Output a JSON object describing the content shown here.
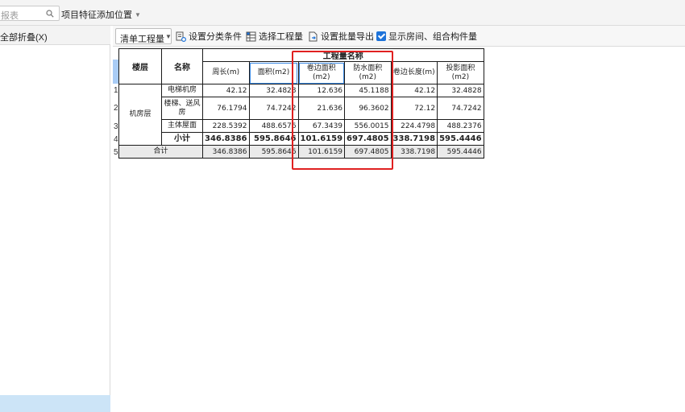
{
  "topbar": {
    "search_placeholder": "报表",
    "feature_position_label": "项目特征添加位置"
  },
  "left_pane": {
    "collapse_all_label": "全部折叠(X)"
  },
  "toolbar": {
    "qty_select_value": "清单工程量",
    "set_category_label": "设置分类条件",
    "select_qty_label": "选择工程量",
    "batch_export_label": "设置批量导出",
    "show_rooms_label": "显示房间、组合构件量",
    "show_rooms_checked": true
  },
  "report": {
    "header": {
      "floor": "楼层",
      "name": "名称",
      "group": "工程量名称",
      "columns": [
        "周长(m)",
        "面积(m2)",
        "卷边面积(m2)",
        "防水面积(m2)",
        "卷边长度(m)",
        "投影面积(m2)"
      ]
    },
    "row_numbers": [
      "1",
      "2",
      "3",
      "4",
      "5"
    ],
    "floor_label": "机房层",
    "rows": [
      {
        "name": "电梯机房",
        "values": [
          "42.12",
          "32.4828",
          "12.636",
          "45.1188",
          "42.12",
          "32.4828"
        ]
      },
      {
        "name": "楼梯、送风房",
        "values": [
          "76.1794",
          "74.7242",
          "21.636",
          "96.3602",
          "72.12",
          "74.7242"
        ]
      },
      {
        "name": "主体屋面",
        "values": [
          "228.5392",
          "488.6576",
          "67.3439",
          "556.0015",
          "224.4798",
          "488.2376"
        ]
      }
    ],
    "subtotal": {
      "label": "小计",
      "values": [
        "346.8386",
        "595.8646",
        "101.6159",
        "697.4805",
        "338.7198",
        "595.4446"
      ]
    },
    "total": {
      "label": "合计",
      "values": [
        "346.8386",
        "595.8646",
        "101.6159",
        "697.4805",
        "338.7198",
        "595.4446"
      ]
    }
  },
  "colors": {
    "highlight_box": "#e02020",
    "selection_blue": "#cce4f7",
    "checkbox_blue": "#1e73d9"
  }
}
